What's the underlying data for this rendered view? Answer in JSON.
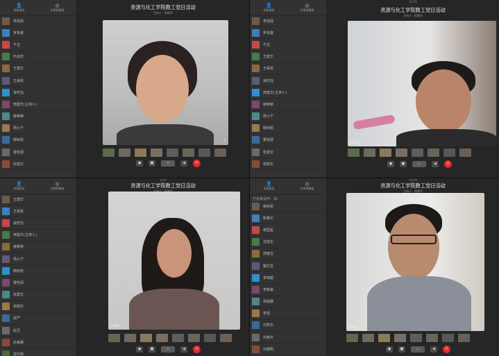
{
  "meeting": {
    "title": "资源与化工学院教工党日活动",
    "host_label": "主持人：邢建华",
    "timer_q2": "42:55",
    "timer_q3": "4:00",
    "timer_q4": "54:20"
  },
  "sidebar": {
    "add_member_label": "添加成员",
    "share_label": "分享到微信",
    "online_count_label": "已在会议中：31",
    "q1_participants": [
      "李强强",
      "罗青春",
      "牛玉",
      "石凉忠",
      "王建华",
      "王昊凯",
      "肖旺钰",
      "邢建华(主持人)",
      "薛荣荣",
      "杨小宁",
      "柳树凯",
      "曹桂源",
      "张建文"
    ],
    "q2_participants": [
      "李强强",
      "罗青春",
      "牛玉",
      "王建华",
      "王昊凯",
      "肖旺钰",
      "邢建华(主持人)",
      "薛荣荣",
      "杨小宁",
      "柳树凯",
      "曹桂源",
      "张建文",
      "张丽华"
    ],
    "q3_participants": [
      "王建华",
      "王昊凯",
      "肖旺钰",
      "邢建华(主持人)",
      "薛荣荣",
      "杨小宁",
      "柳树凯",
      "曹桂源",
      "张建文",
      "张丽华",
      "张严",
      "赵灵",
      "赵美娜",
      "郑文辉"
    ],
    "q4_participants": [
      "柳树凯",
      "陈春乐",
      "谢国星",
      "范成生",
      "郭春玉",
      "戴文思",
      "李瑞超",
      "李鲁甫",
      "林妮娜",
      "李强",
      "刘秀华",
      "刘艳平",
      "刘德明"
    ]
  },
  "videos": {
    "q2_speaker_label": "石凉忠",
    "q3_speaker_label": "李瑞超",
    "q4_speaker_label": "柳树凯"
  },
  "controls": {
    "mic_icon": "microphone-icon",
    "camera_icon": "camera-icon",
    "screen_icon": "screen-share-icon",
    "speaker_icon": "speaker-icon",
    "end_icon": "hang-up-icon"
  },
  "colors": {
    "end_call": "#e02a2a",
    "panel": "#323232",
    "stage": "#262626"
  }
}
